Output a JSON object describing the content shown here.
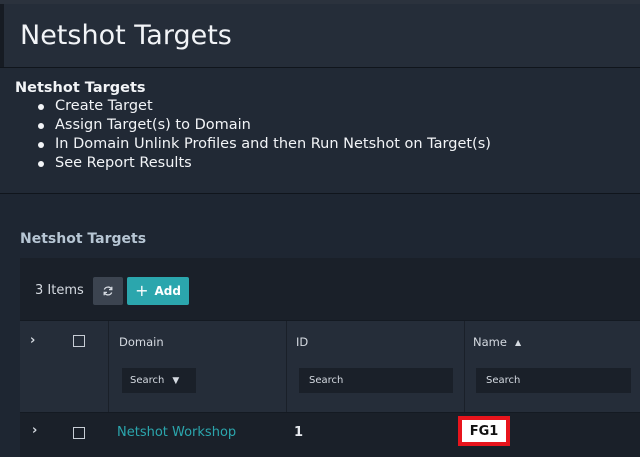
{
  "page": {
    "title": "Netshot Targets"
  },
  "info": {
    "heading": "Netshot Targets",
    "items": [
      "Create Target",
      "Assign Target(s) to Domain",
      "In Domain Unlink Profiles and then Run Netshot on Target(s)",
      "See Report Results"
    ]
  },
  "grid": {
    "section_title": "Netshot Targets",
    "item_count": "3 Items",
    "add_label": "Add",
    "columns": {
      "domain": "Domain",
      "id": "ID",
      "name": "Name"
    },
    "filters": {
      "domain_select": "Search",
      "id_placeholder": "Search",
      "name_placeholder": "Search"
    },
    "sort": {
      "column": "name",
      "direction": "ascending"
    },
    "rows": [
      {
        "domain": "Netshot Workshop",
        "id": "1",
        "name": "FG1"
      }
    ]
  },
  "icons": {
    "refresh": "refresh-icon",
    "add": "plus-icon",
    "expand": "chevron-right-icon",
    "sort": "sort-ascending-icon",
    "select_caret": "caret-down-icon"
  },
  "colors": {
    "accent": "#2ba6ad",
    "highlight": "#e8141c",
    "background": "#1e2632"
  }
}
